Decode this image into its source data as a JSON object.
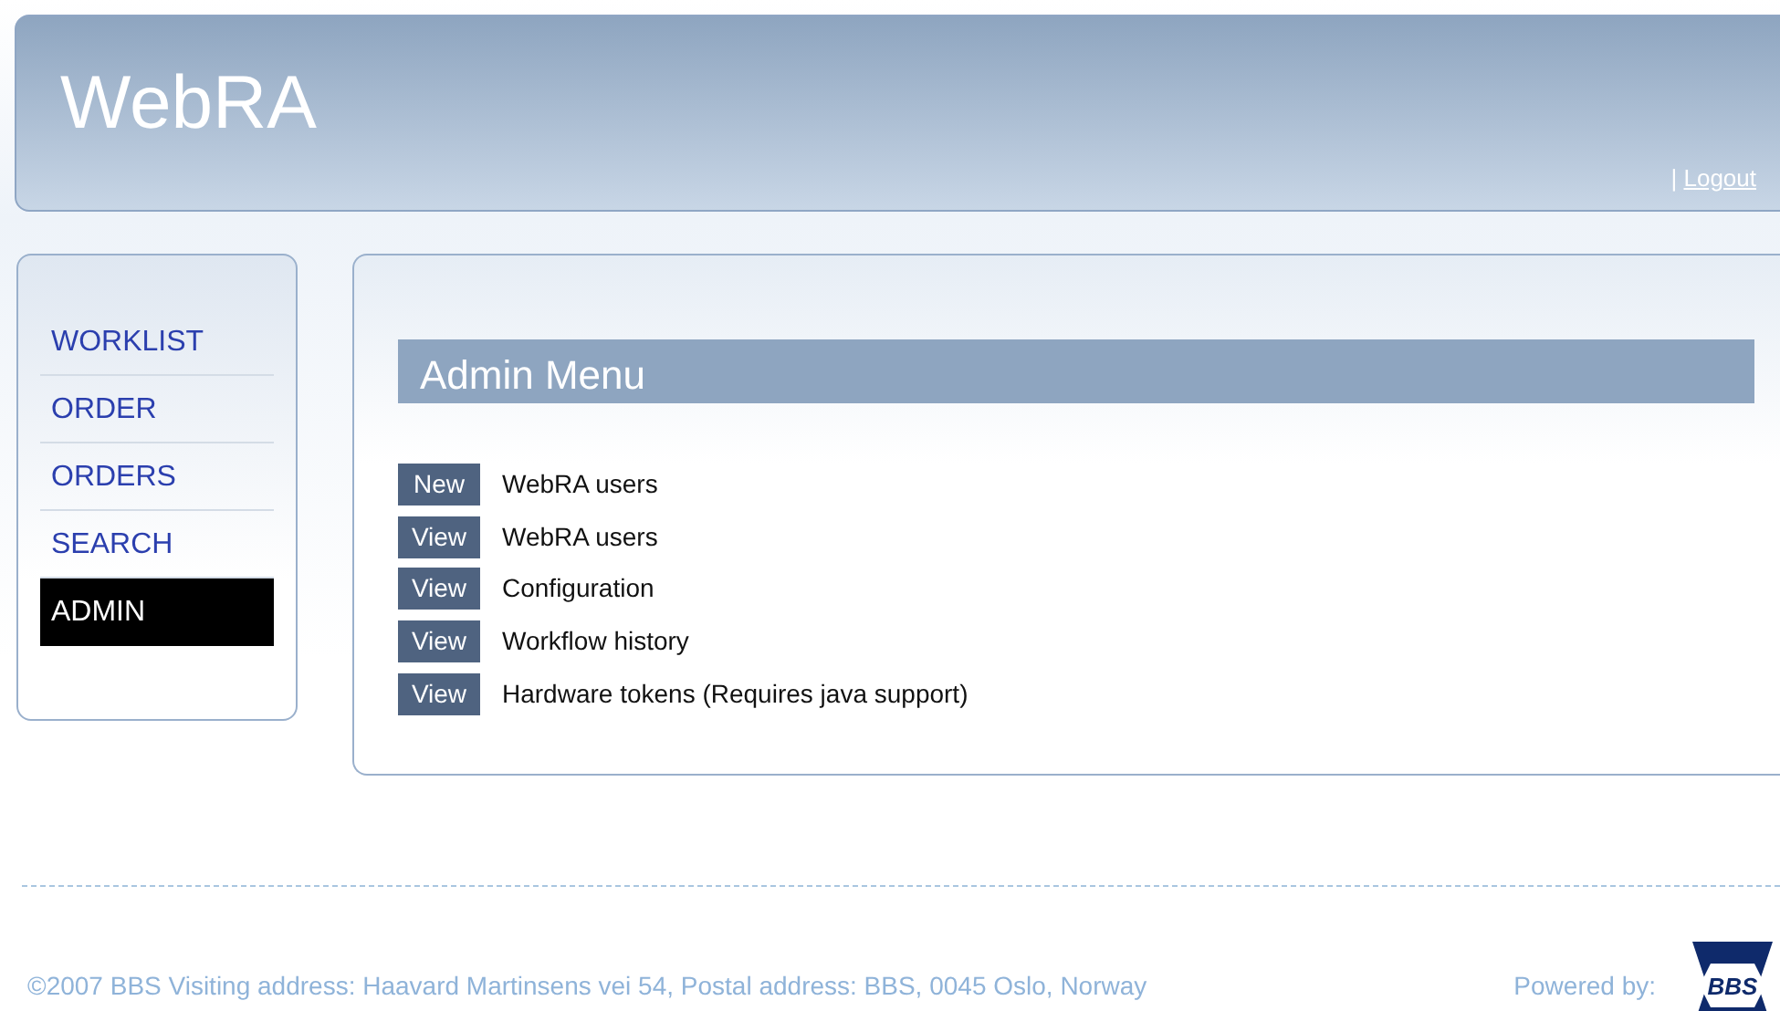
{
  "header": {
    "title": "WebRA",
    "separator": "|",
    "logout": "Logout"
  },
  "sidebar": {
    "items": [
      {
        "label": "WORKLIST",
        "selected": false
      },
      {
        "label": "ORDER",
        "selected": false
      },
      {
        "label": "ORDERS",
        "selected": false
      },
      {
        "label": "SEARCH",
        "selected": false
      },
      {
        "label": "ADMIN",
        "selected": true
      }
    ]
  },
  "admin_menu": {
    "title": "Admin Menu",
    "entries": [
      {
        "action": "New",
        "label": "WebRA users"
      },
      {
        "action": "View",
        "label": "WebRA users"
      },
      {
        "action": "View",
        "label": "Configuration"
      },
      {
        "action": "View",
        "label": "Workflow history"
      },
      {
        "action": "View",
        "label": "Hardware tokens (Requires java support)"
      }
    ]
  },
  "footer": {
    "text": "©2007 BBS Visiting address: Haavard Martinsens vei 54, Postal address: BBS, 0045 Oslo, Norway",
    "powered_by": "Powered by:",
    "logo_text": "BBS"
  }
}
